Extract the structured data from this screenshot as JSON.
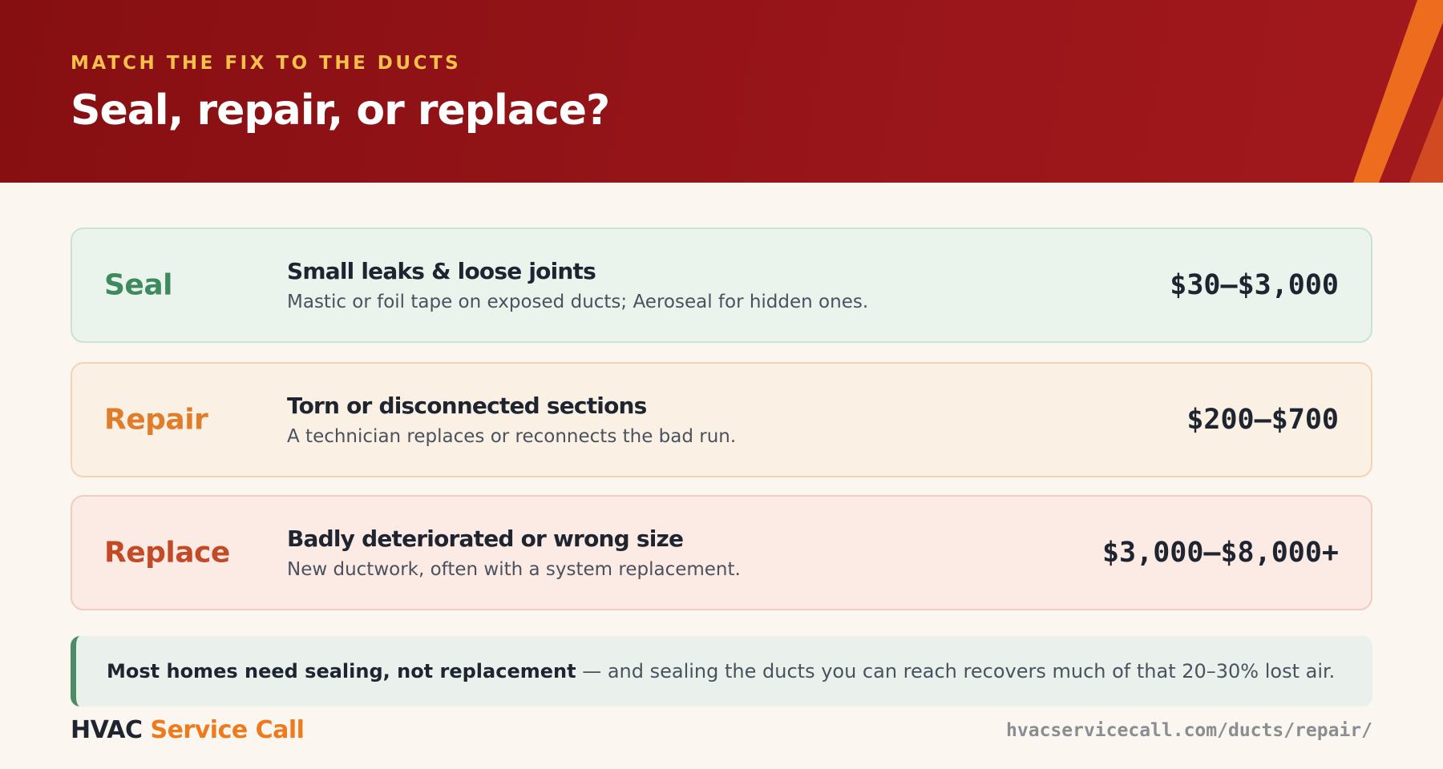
{
  "header": {
    "eyebrow": "MATCH THE FIX TO THE DUCTS",
    "title": "Seal, repair, or replace?"
  },
  "options": [
    {
      "label": "Seal",
      "heading": "Small leaks & loose joints",
      "description": "Mastic or foil tape on exposed ducts; Aeroseal for hidden ones.",
      "price": "$30–$3,000"
    },
    {
      "label": "Repair",
      "heading": "Torn or disconnected sections",
      "description": "A technician replaces or reconnects the bad run.",
      "price": "$200–$700"
    },
    {
      "label": "Replace",
      "heading": "Badly deteriorated or wrong size",
      "description": "New ductwork, often with a system replacement.",
      "price": "$3,000–$8,000+"
    }
  ],
  "note": {
    "bold": "Most homes need sealing, not replacement",
    "text": " — and sealing the ducts you can reach recovers much of that 20–30% lost air."
  },
  "footer": {
    "brand_part1": "HVAC",
    "brand_part2": " Service Call",
    "url": "hvacservicecall.com/ducts/repair/"
  },
  "colors": {
    "header_bg": "#971519",
    "eyebrow": "#f6c04a",
    "seal": "#3d8a5e",
    "repair": "#e07d2a",
    "replace": "#c24a26",
    "brand_accent": "#ee7a1c"
  }
}
